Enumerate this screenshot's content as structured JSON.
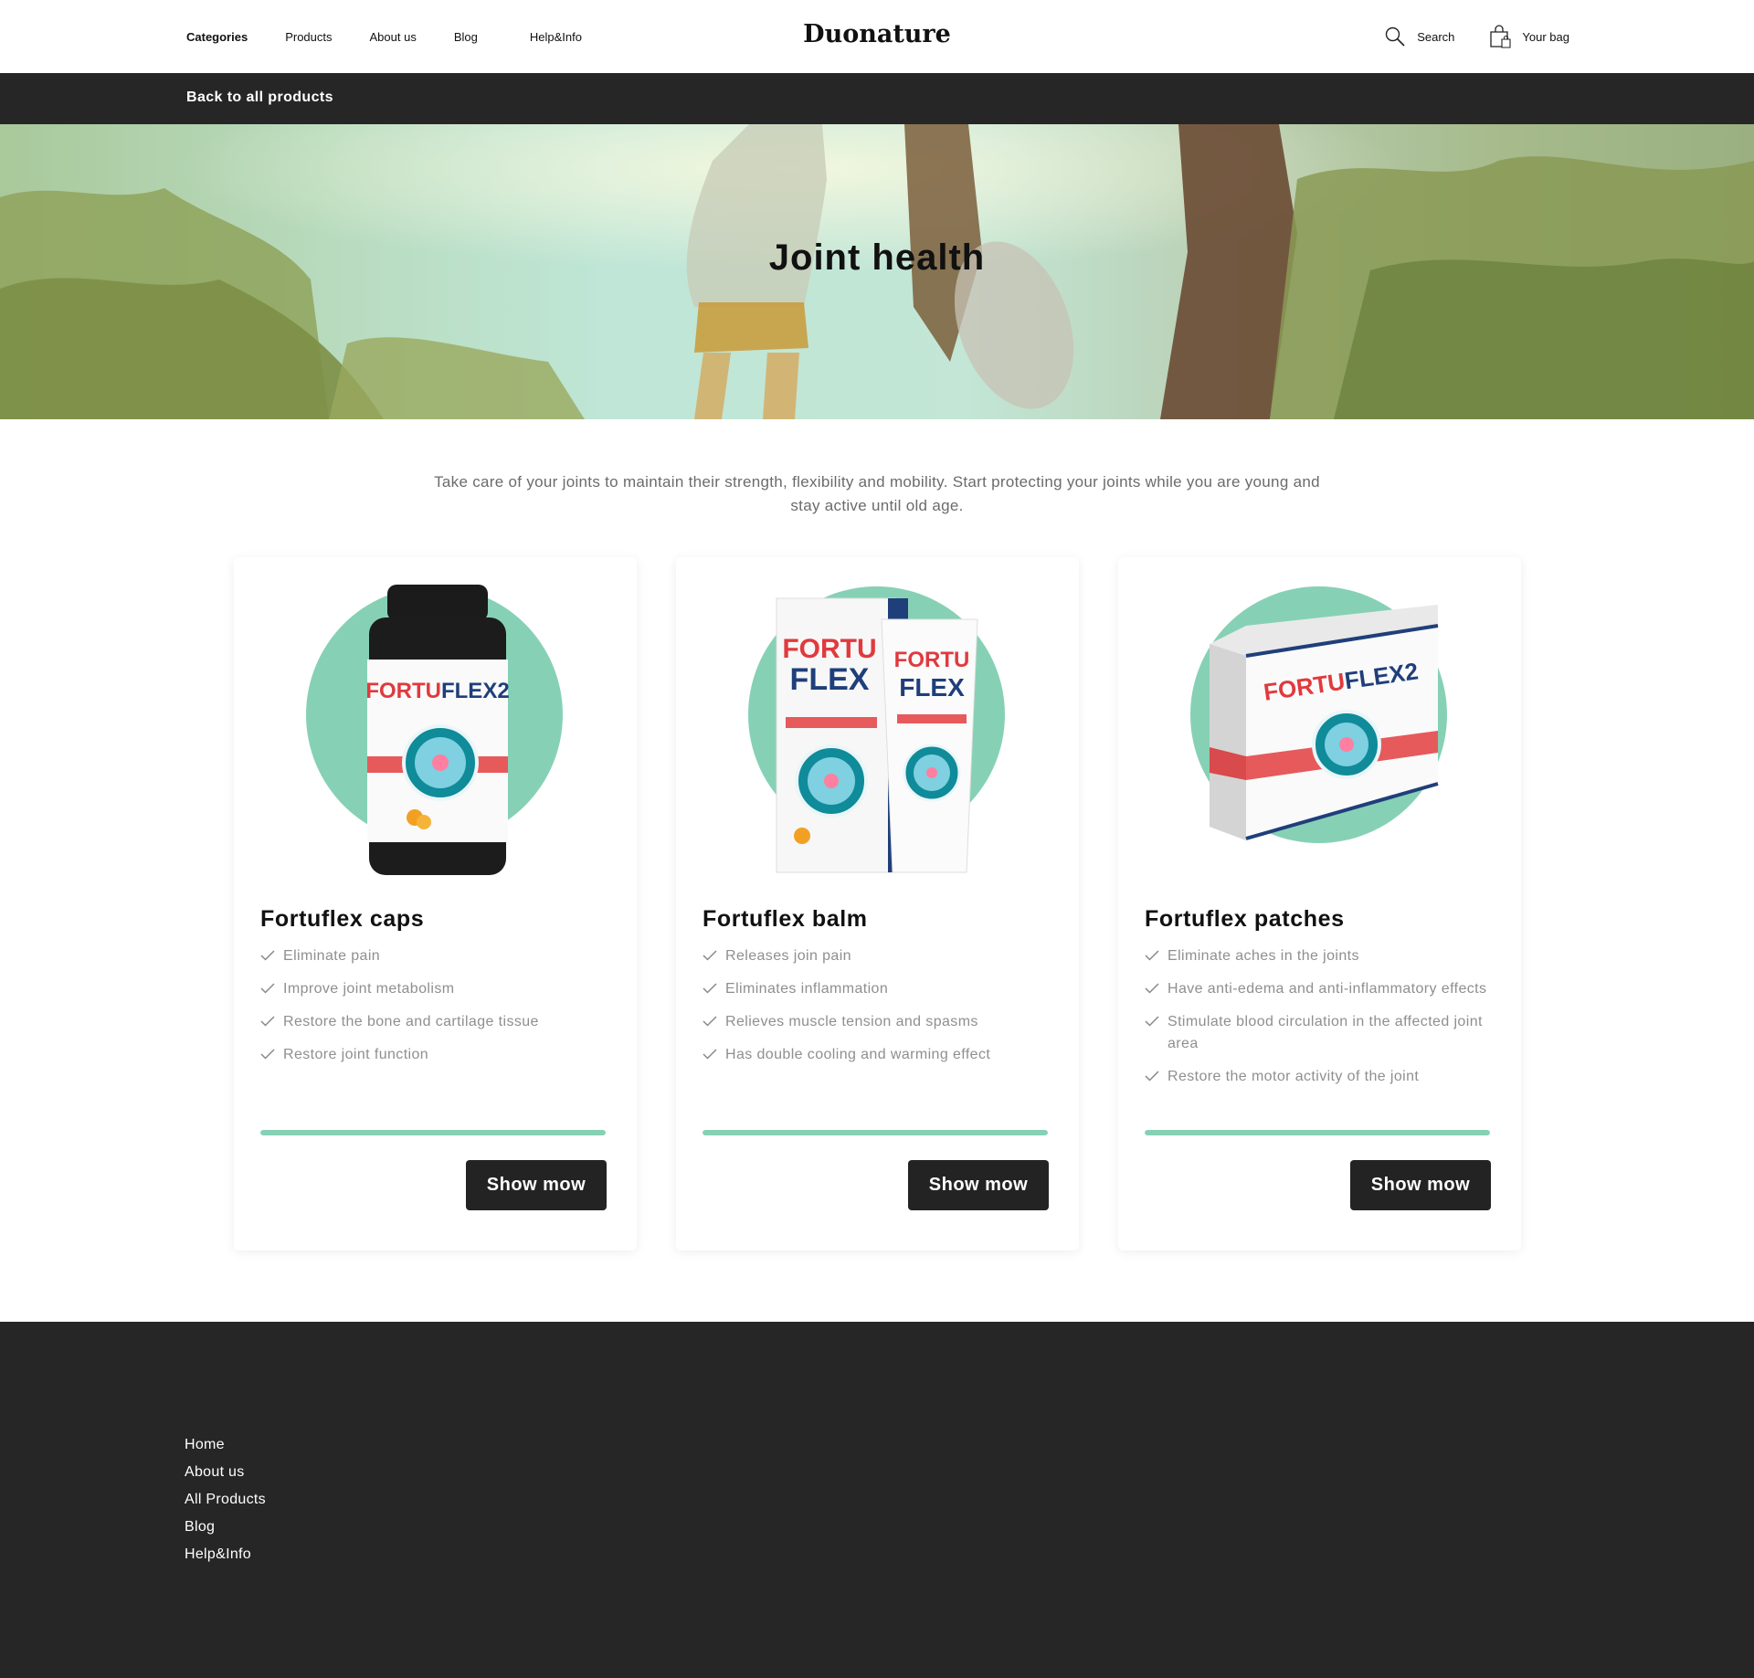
{
  "brand": {
    "logo": "Duonature"
  },
  "nav": {
    "items": [
      {
        "label": "Categories",
        "active": true
      },
      {
        "label": "Products"
      },
      {
        "label": "About us"
      },
      {
        "label": "Blog"
      },
      {
        "label": "Help&Info"
      }
    ]
  },
  "tools": {
    "search_label": "Search",
    "bag_label": "Your bag"
  },
  "backbar": {
    "label": "Back to all products"
  },
  "hero": {
    "title": "Joint health"
  },
  "intro": {
    "text": "Take care of your joints to maintain their strength, flexibility and mobility. Start protecting your joints while you are young and stay active until old age."
  },
  "products": [
    {
      "name": "Fortuflex caps",
      "features": [
        "Eliminate pain",
        "Improve joint metabolism",
        "Restore the bone and cartilage tissue",
        "Restore joint function"
      ],
      "progress": 1.0,
      "button": "Show mow",
      "image_text": {
        "brand_a": "FORTU",
        "brand_b": "FLEX2"
      }
    },
    {
      "name": "Fortuflex balm",
      "features": [
        "Releases join pain",
        "Eliminates inflammation",
        "Relieves muscle tension and spasms",
        "Has double cooling and warming effect"
      ],
      "progress": 1.0,
      "button": "Show mow",
      "image_text": {
        "brand_a": "FORTU",
        "brand_b": "FLEX"
      }
    },
    {
      "name": "Fortuflex patches",
      "features": [
        "Eliminate aches in the joints",
        "Have anti-edema and anti-inflammatory effects",
        "Stimulate blood circulation in the affected joint area",
        "Restore the motor activity of the joint"
      ],
      "progress": 1.0,
      "button": "Show mow",
      "image_text": {
        "brand_a": "FORTU",
        "brand_b": "FLEX2"
      }
    }
  ],
  "footer": {
    "links": [
      "Home",
      "About us",
      "All Products",
      "Blog",
      "Help&Info"
    ]
  },
  "colors": {
    "accent": "#86d1b5",
    "dark": "#262626",
    "button": "#232323",
    "brand_red": "#e03a3e",
    "brand_blue": "#1f3f7a"
  },
  "icons": {
    "search": "search-icon",
    "bag": "shopping-bag-icon",
    "check": "check-icon"
  }
}
